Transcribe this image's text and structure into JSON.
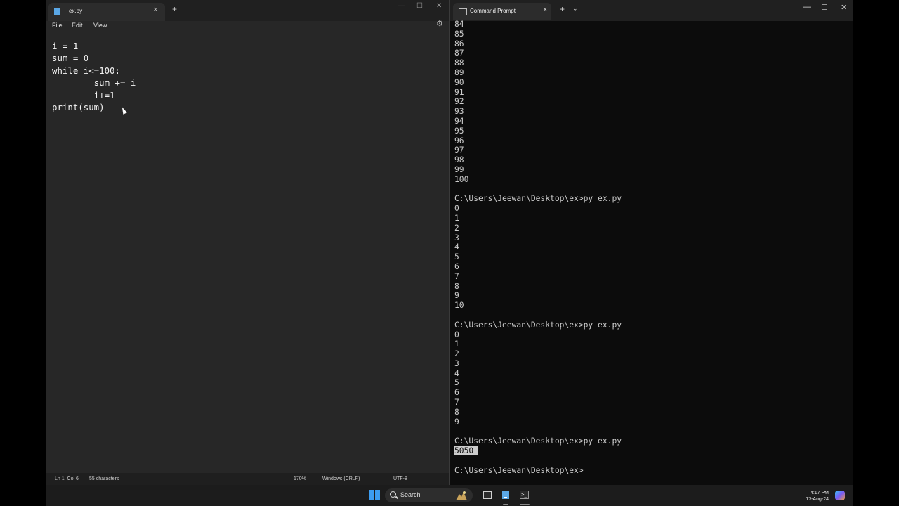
{
  "notepad": {
    "tab_title": "ex.py",
    "tab_close": "×",
    "new_tab": "+",
    "window_buttons": [
      "—",
      "☐",
      "✕"
    ],
    "menu": [
      "File",
      "Edit",
      "View"
    ],
    "code": "i = 1\nsum = 0\nwhile i<=100:\n        sum += i\n        i+=1\nprint(sum)",
    "status": {
      "position": "Ln 1, Col 6",
      "characters": "55 characters",
      "zoom": "170%",
      "line_ending": "Windows (CRLF)",
      "encoding": "UTF-8"
    }
  },
  "terminal": {
    "tab_title": "Command Prompt",
    "tab_close": "×",
    "new_tab": "+",
    "dropdown": "⌄",
    "window_buttons": [
      "—",
      "☐",
      "✕"
    ],
    "output_before": "84\n85\n86\n87\n88\n89\n90\n91\n92\n93\n94\n95\n96\n97\n98\n99\n100\n\nC:\\Users\\Jeewan\\Desktop\\ex>py ex.py\n0\n1\n2\n3\n4\n5\n6\n7\n8\n9\n10\n\nC:\\Users\\Jeewan\\Desktop\\ex>py ex.py\n0\n1\n2\n3\n4\n5\n6\n7\n8\n9\n\nC:\\Users\\Jeewan\\Desktop\\ex>py ex.py\n",
    "result": "5050 ",
    "output_after": "\n\nC:\\Users\\Jeewan\\Desktop\\ex>"
  },
  "taskbar": {
    "search_label": "Search",
    "time": "4:17 PM",
    "date": "17-Aug-24",
    "accent": "#3c9cf0"
  }
}
